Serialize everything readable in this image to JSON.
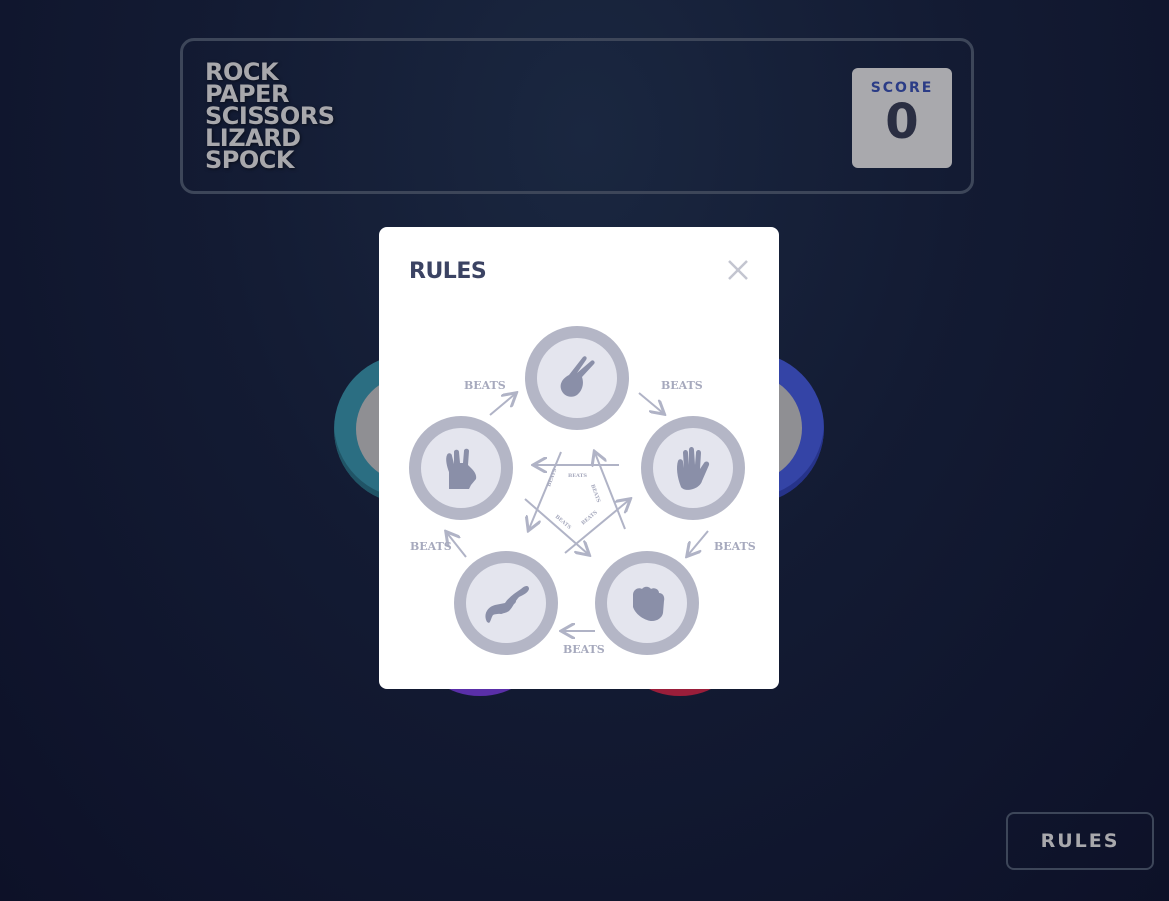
{
  "header": {
    "title_lines": [
      "ROCK",
      "PAPER",
      "SCISSORS",
      "LIZARD",
      "SPOCK"
    ],
    "score_label": "SCORE",
    "score_value": "0"
  },
  "modal": {
    "title": "RULES",
    "close_icon": "close-icon",
    "diagram": {
      "choices": [
        "scissors",
        "paper",
        "rock",
        "lizard",
        "spock"
      ],
      "edge_label": "BEATS",
      "icon_names": {
        "scissors": "scissors-hand-icon",
        "paper": "paper-hand-icon",
        "rock": "rock-fist-icon",
        "lizard": "lizard-icon",
        "spock": "spock-hand-icon"
      }
    }
  },
  "footer": {
    "rules_button": "RULES"
  },
  "colors": {
    "background": "#131b33",
    "header_border": "#3d4659",
    "score_label": "#2b3c86",
    "score_value": "#2a2e42",
    "diagram_gray": "#b4b6c6",
    "icon_fill": "#8a8fa8"
  }
}
